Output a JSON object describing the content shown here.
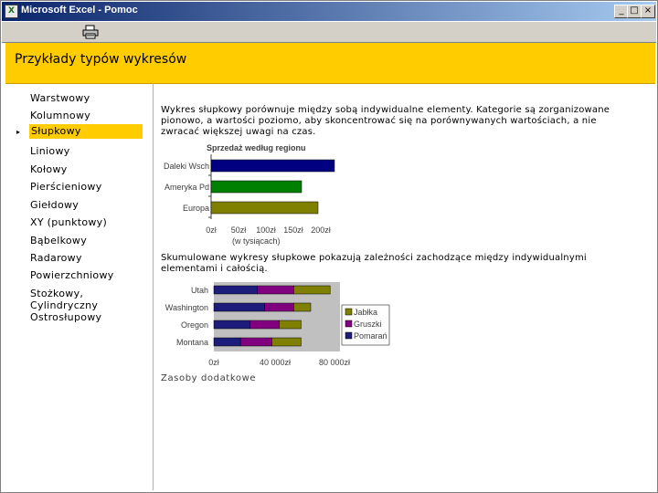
{
  "window": {
    "title": "Microsoft Excel - Pomoc",
    "buttons": [
      "_",
      "□",
      "×"
    ]
  },
  "toolbar": {
    "print_icon": "printer-icon"
  },
  "banner": {
    "title": "Przykłady typów wykresów"
  },
  "nav": {
    "items": [
      {
        "label": "Warstwowy"
      },
      {
        "label": "Kolumnowy"
      },
      {
        "label": "Słupkowy",
        "selected": true
      },
      {
        "label": "Liniowy"
      },
      {
        "label": "Kołowy"
      },
      {
        "label": "Pierścieniowy"
      },
      {
        "label": "Giełdowy"
      },
      {
        "label": "XY (punktowy)"
      },
      {
        "label": "Bąbelkowy"
      },
      {
        "label": "Radarowy"
      },
      {
        "label": "Powierzchniowy"
      },
      {
        "label": "Stożkowy,"
      },
      {
        "label": "Cylindryczny"
      },
      {
        "label": "Ostrosłupowy"
      }
    ],
    "selected_marker": "▸"
  },
  "content": {
    "para1": "Wykres słupkowy porównuje między sobą indywidualne elementy. Kategorie są zorganizowane pionowo, a wartości poziomo, aby skoncentrować się na porównywanych wartościach, a nie zwracać większej uwagi na czas.",
    "para2": "Skumulowane wykresy słupkowe pokazują zależności zachodzące między indywidualnymi elementami i całością.",
    "more_link": "Zasoby dodatkowe"
  },
  "colors": {
    "banner": "#ffcc00",
    "bar_blue": "#000080",
    "bar_green": "#008000",
    "bar_olive": "#808000",
    "series_navy": "#1c1c7a",
    "series_purple": "#800080",
    "series_olive": "#808000"
  },
  "chart_data": [
    {
      "type": "bar",
      "title": "Sprzedaż według regionu",
      "xlabel": "(w tysiącach)",
      "categories": [
        "Daleki Wsch",
        "Ameryka Pd",
        "Europa"
      ],
      "values": [
        225,
        165,
        195
      ],
      "bar_colors": [
        "#000080",
        "#008000",
        "#808000"
      ],
      "xlim": [
        0,
        200
      ],
      "ticks": [
        "0zł",
        "50zł",
        "100zł",
        "150zł",
        "200zł"
      ],
      "orientation": "horizontal"
    },
    {
      "type": "bar",
      "stacked": true,
      "orientation": "horizontal",
      "categories": [
        "Utah",
        "Washington",
        "Oregon",
        "Montana"
      ],
      "series": [
        {
          "name": "Jabłka",
          "values": [
            15,
            7,
            9,
            12
          ],
          "color": "#808000"
        },
        {
          "name": "Gruszki",
          "values": [
            15,
            12,
            12,
            13
          ],
          "color": "#800080"
        },
        {
          "name": "Pomarańcze",
          "values": [
            18,
            21,
            15,
            11
          ],
          "color": "#1c1c7a"
        }
      ],
      "legend_labels": [
        "Jabłka",
        "Gruszki",
        "Pomarań"
      ],
      "xlim": [
        0,
        80000
      ],
      "ticks": [
        "0zł",
        "40 000zł",
        "80 000zł"
      ],
      "legend": "right"
    }
  ]
}
